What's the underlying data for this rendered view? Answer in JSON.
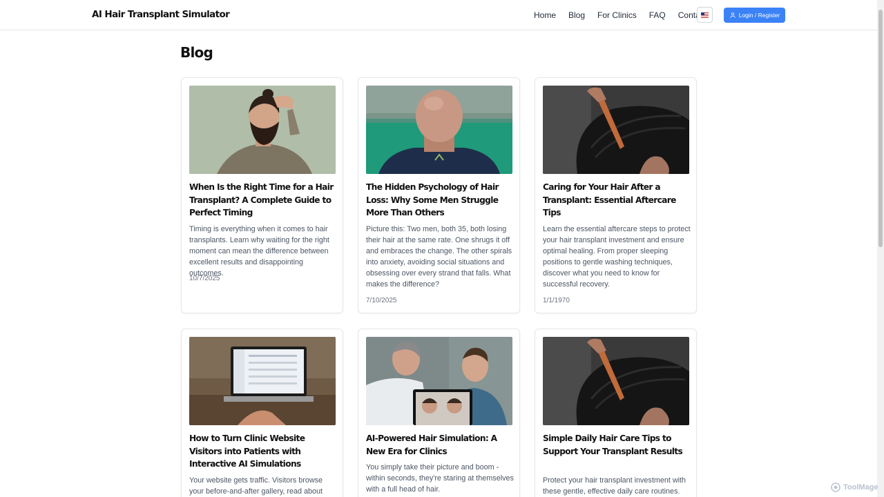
{
  "header": {
    "brand": "AI Hair Transplant Simulator",
    "nav": [
      "Home",
      "Blog",
      "For Clinics",
      "FAQ",
      "Contact"
    ],
    "language_icon": "us-flag-icon",
    "login_label": "Login / Register"
  },
  "page": {
    "title": "Blog"
  },
  "posts": [
    {
      "title": "When Is the Right Time for a Hair Transplant? A Complete Guide to Perfect Timing",
      "excerpt": "Timing is everything when it comes to hair transplants. Learn why waiting for the right moment can mean the difference between excellent results and disappointing outcomes.",
      "date": "10/7/2025",
      "image": "man-touching-hair-photo"
    },
    {
      "title": "The Hidden Psychology of Hair Loss: Why Some Men Struggle More Than Others",
      "excerpt": "Picture this: Two men, both 35, both losing their hair at the same rate. One shrugs it off and embraces the change. The other spirals into anxiety, avoiding social situations and obsessing over every strand that falls. What makes the difference?",
      "date": "7/10/2025",
      "image": "bald-man-back-photo"
    },
    {
      "title": "Caring for Your Hair After a Transplant: Essential Aftercare Tips",
      "excerpt": "Learn the essential aftercare steps to protect your hair transplant investment and ensure optimal healing. From proper sleeping positions to gentle washing techniques, discover what you need to know for successful recovery.",
      "date": "1/1/1970",
      "image": "comb-hair-photo"
    },
    {
      "title": "How to Turn Clinic Website Visitors into Patients with Interactive AI Simulations",
      "excerpt": "Your website gets traffic. Visitors browse your before-and-after gallery, read about your",
      "date": "",
      "image": "laptop-dashboard-photo"
    },
    {
      "title": "AI-Powered Hair Simulation: A New Era for Clinics",
      "excerpt": "You simply take their picture and boom - within seconds, they're staring at themselves with a full head of hair.",
      "date": "",
      "image": "doctor-patient-tablet-photo"
    },
    {
      "title": "Simple Daily Hair Care Tips to Support Your Transplant Results",
      "excerpt": "Protect your hair transplant investment with these gentle, effective daily care routines.",
      "date": "",
      "image": "comb-hair-photo"
    }
  ],
  "watermark": "ToolMage"
}
